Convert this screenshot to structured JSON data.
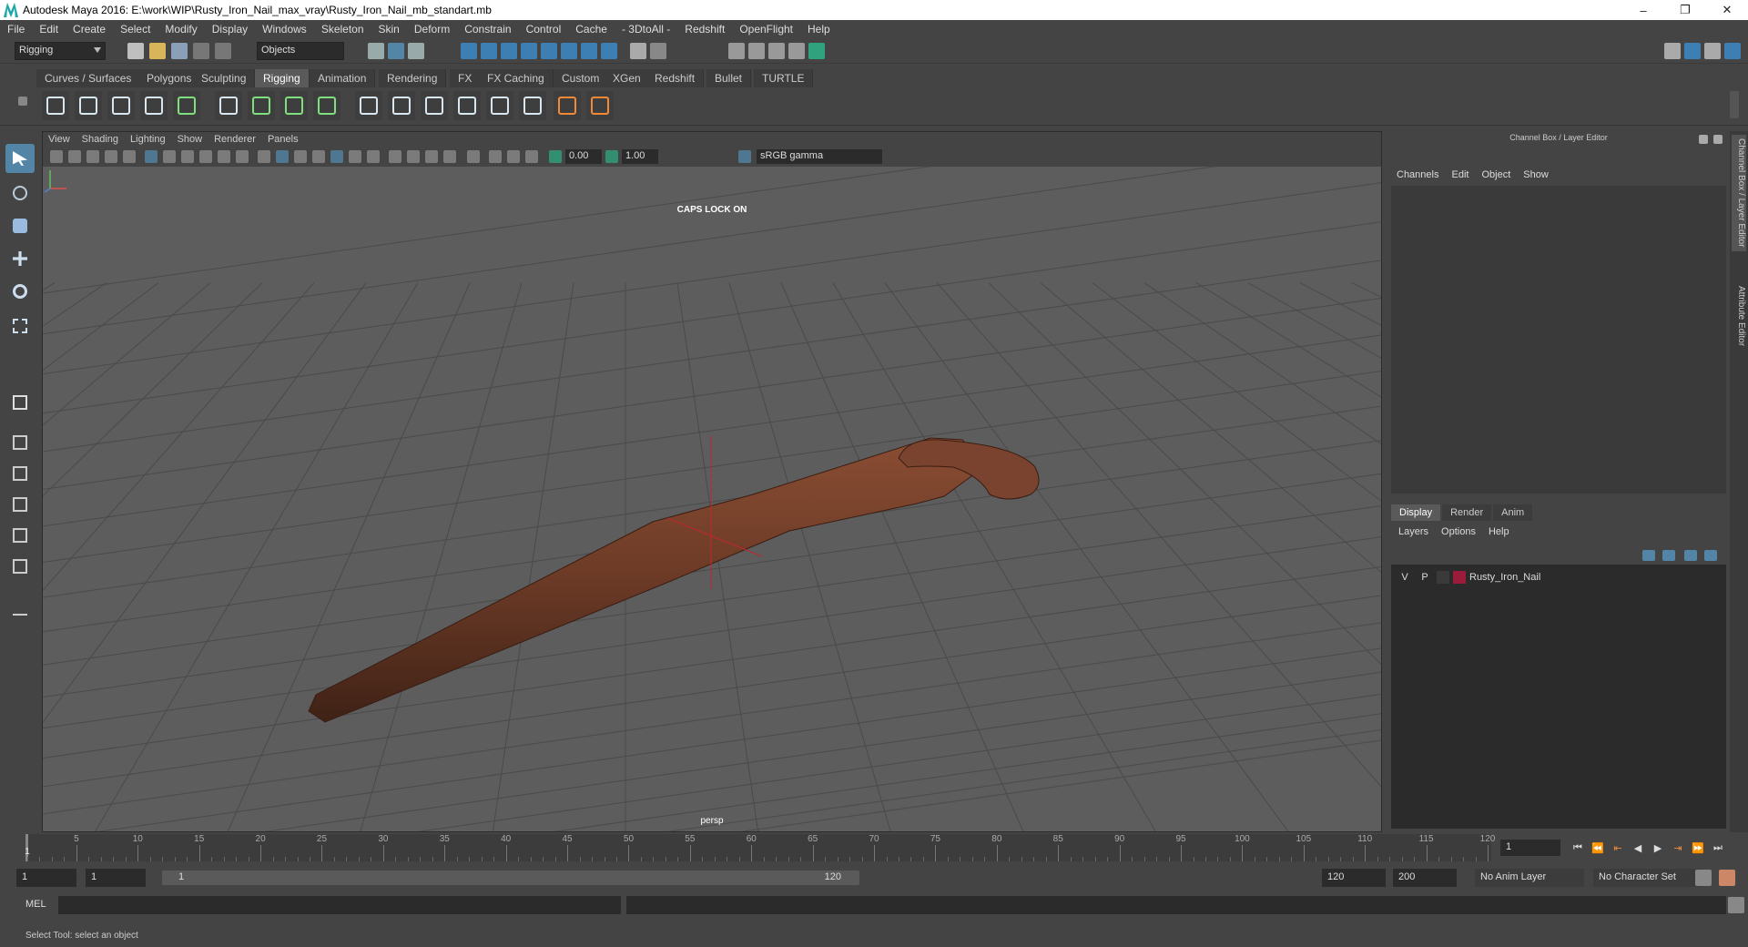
{
  "window": {
    "title": "Autodesk Maya 2016: E:\\work\\WIP\\Rusty_Iron_Nail_max_vray\\Rusty_Iron_Nail_mb_standart.mb",
    "minimize": "–",
    "maximize": "❐",
    "close": "✕"
  },
  "menubar": [
    "File",
    "Edit",
    "Create",
    "Select",
    "Modify",
    "Display",
    "Windows",
    "Skeleton",
    "Skin",
    "Deform",
    "Constrain",
    "Control",
    "Cache",
    "- 3DtoAll -",
    "Redshift",
    "OpenFlight",
    "Help"
  ],
  "statusline": {
    "menuset": "Rigging",
    "selection_mode": "Objects"
  },
  "shelf_tabs": [
    "Curves / Surfaces",
    "Polygons",
    "Sculpting",
    "Rigging",
    "Animation",
    "Rendering",
    "FX",
    "FX Caching",
    "Custom",
    "XGen",
    "Redshift",
    "Bullet",
    "TURTLE"
  ],
  "shelf_active_tab": "Rigging",
  "viewport": {
    "menus": [
      "View",
      "Shading",
      "Lighting",
      "Show",
      "Renderer",
      "Panels"
    ],
    "exposure": "0.00",
    "gamma": "1.00",
    "color_space": "sRGB gamma",
    "caps_lock_message": "CAPS LOCK ON",
    "camera_label": "persp"
  },
  "right_panel": {
    "title": "Channel Box / Layer Editor",
    "channel_menus": [
      "Channels",
      "Edit",
      "Object",
      "Show"
    ],
    "layer_tabs": [
      "Display",
      "Render",
      "Anim"
    ],
    "layer_active_tab": "Display",
    "layer_menus": [
      "Layers",
      "Options",
      "Help"
    ],
    "layers": [
      {
        "visible": "V",
        "playback": "P",
        "color": "#9b1c3a",
        "name": "Rusty_Iron_Nail"
      }
    ]
  },
  "side_tabs": [
    "Channel Box / Layer Editor",
    "Attribute Editor"
  ],
  "timeslider": {
    "tick_labels": [
      "5",
      "10",
      "15",
      "20",
      "25",
      "30",
      "35",
      "40",
      "45",
      "50",
      "55",
      "60",
      "65",
      "70",
      "75",
      "80",
      "85",
      "90",
      "95",
      "100",
      "105",
      "110",
      "115",
      "120"
    ],
    "first_frame_label": "1",
    "current_frame": "1",
    "start": 1,
    "end": 120
  },
  "rangeslider": {
    "start_field": "1",
    "playback_start": "1",
    "range_start_label": "1",
    "range_end_label": "120",
    "playback_end": "120",
    "end_field": "200",
    "anim_layer": "No Anim Layer",
    "character_set": "No Character Set"
  },
  "cmdline": {
    "label": "MEL"
  },
  "helpline": {
    "text": "Select Tool: select an object"
  },
  "colors": {
    "accent": "#5285a6",
    "nail": "#6b3a26",
    "grid": "#4a4a4a"
  }
}
